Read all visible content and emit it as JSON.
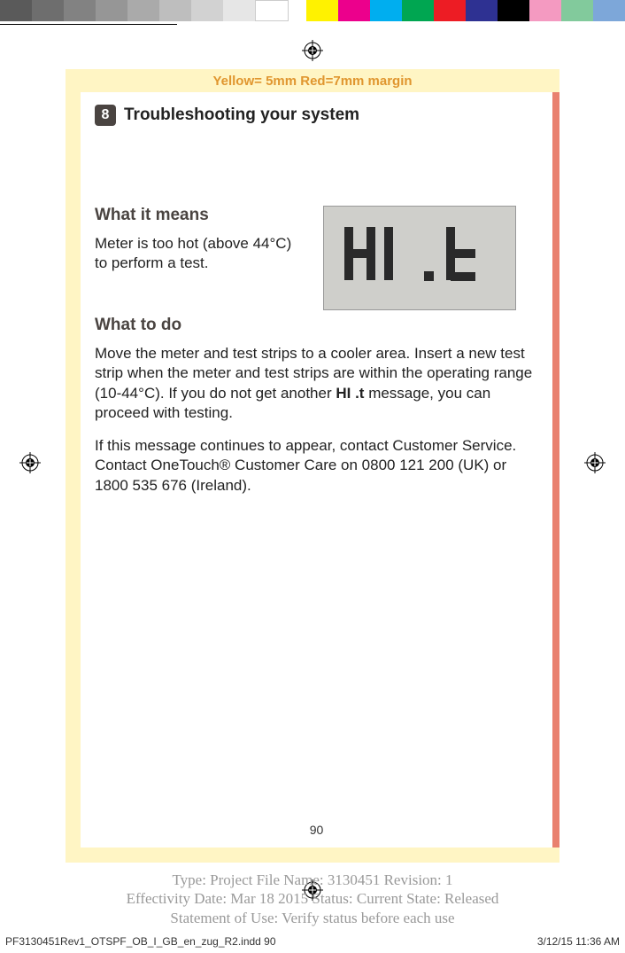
{
  "bleed_note": "Yellow= 5mm  Red=7mm margin",
  "chapter": {
    "number": "8",
    "title": "Troubleshooting your system"
  },
  "sections": {
    "what_it_means": {
      "heading": "What it means",
      "body": "Meter is too hot (above 44°C) to perform a test."
    },
    "what_to_do": {
      "heading": "What to do",
      "body1_a": "Move the meter and test strips to a cooler area. Insert a new test strip when the meter and test strips are within the operating range (10-44°C). If you do not get another ",
      "body1_b": "HI .t",
      "body1_c": " message, you can proceed with testing.",
      "body2": "If this message continues to appear, contact Customer Service. Contact OneTouch® Customer Care on 0800 121 200 (UK) or 1800 535 676 (Ireland)."
    }
  },
  "lcd_display": "HI .t",
  "page_number": "90",
  "meta": {
    "line1": "Type: Project File  Name: 3130451  Revision: 1",
    "line2": "Effectivity Date: Mar 18 2015     Status: Current     State: Released",
    "line3": "Statement of Use: Verify status before each use"
  },
  "footer": {
    "file": "PF3130451Rev1_OTSPF_OB_I_GB_en_zug_R2.indd   90",
    "timestamp": "3/12/15   11:36 AM"
  },
  "color_bars": [
    "#5a5a5a",
    "#6e6e6e",
    "#828282",
    "#969696",
    "#aaaaaa",
    "#bebebe",
    "#d2d2d2",
    "#e6e6e6",
    "#ffffff",
    null,
    "#fff200",
    "#ec008c",
    "#00aeef",
    "#00a651",
    "#ed1c24",
    "#2e3192",
    "#000000",
    "#f49ac1",
    "#82ca9c",
    "#7da7d9"
  ]
}
